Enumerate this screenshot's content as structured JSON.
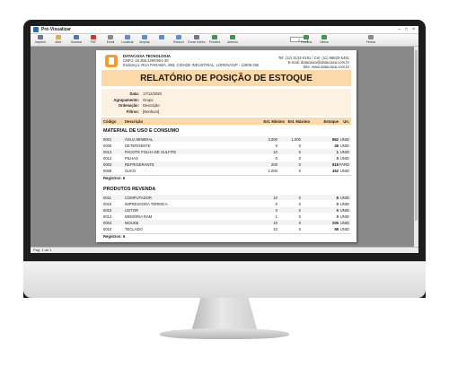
{
  "window": {
    "title": "Pré-Visualizar",
    "controls": [
      "–",
      "□",
      "×"
    ]
  },
  "toolbar": {
    "buttons": [
      {
        "label": "Imprimir",
        "icon": "printer-icon",
        "color": "#6b7a8c"
      },
      {
        "label": "Abrir",
        "icon": "open-folder-icon",
        "color": "#e0b040"
      },
      {
        "label": "Guardar",
        "icon": "save-icon",
        "color": "#4a78b8"
      },
      {
        "label": "PDF",
        "icon": "pdf-icon",
        "color": "#d9342b"
      },
      {
        "label": "Email",
        "icon": "email-icon",
        "color": "#8a8a8a"
      },
      {
        "label": "Localizar",
        "icon": "search-icon",
        "color": "#5a8fd0"
      },
      {
        "label": "Ampliar",
        "icon": "zoom-in-icon",
        "color": "#5a8fd0"
      },
      {
        "label": "",
        "icon": "zoom-icon",
        "color": "#5a8fd0"
      },
      {
        "label": "Reduzir",
        "icon": "zoom-out-icon",
        "color": "#5a8fd0"
      },
      {
        "label": "Ecran Inteiro",
        "icon": "fullscreen-icon",
        "color": "#6b7a8c"
      },
      {
        "label": "Primeira",
        "icon": "first-page-icon",
        "color": "#3a9a4a"
      },
      {
        "label": "Anterior",
        "icon": "previous-page-icon",
        "color": "#3a9a4a"
      },
      {
        "label": "Próxima",
        "icon": "next-page-icon",
        "color": "#3a9a4a"
      },
      {
        "label": "Última",
        "icon": "last-page-icon",
        "color": "#3a9a4a"
      },
      {
        "label": "Fechar",
        "icon": "close-icon",
        "color": "#8a8a8a"
      }
    ],
    "page_number": "1"
  },
  "status": {
    "text": "Pag. 1 de 1"
  },
  "report": {
    "company": {
      "name": "DATACAIXA TECNOLOGIA",
      "cnpj": "CNPJ: 16.356.429/0001-20",
      "address": "Endereço: RUA PARAIBA, 893, CIDADE INDUSTRIAL, LORENA/SP - 12609-250"
    },
    "contact": {
      "phone": "Tel: (12) 2132-0191 / Cel: (11) 98620-5451",
      "email": "E-mail: datacaixa@datacaixa.com.br",
      "site": "Site: www.datacaixa.com.br"
    },
    "title": "RELATÓRIO DE POSIÇÃO DE ESTOQUE",
    "filters": [
      {
        "label": "Data:",
        "value": "17/12/2020"
      },
      {
        "label": "Agrupamento:",
        "value": "Grupo"
      },
      {
        "label": "Ordenação:",
        "value": "Descrição"
      },
      {
        "label": "Filtros:",
        "value": "[Nenhum]"
      }
    ],
    "columns": {
      "code": "Código",
      "description": "Descrição",
      "min": "Est. Mínimo",
      "max": "Est. Máximo",
      "stock": "Estoque",
      "unit": "Un."
    },
    "groups": [
      {
        "title": "MATERIAL DE USO E CONSUMO",
        "rows": [
          {
            "code": "0001",
            "desc": "ÁGUA MINERAL",
            "min": "3.000",
            "max": "1.000",
            "stock": "882",
            "unit": "UNID"
          },
          {
            "code": "0006",
            "desc": "DETERGENTE",
            "min": "0",
            "max": "0",
            "stock": "48",
            "unit": "UNID"
          },
          {
            "code": "0013",
            "desc": "PACOTE FOLHA DE SULFITE",
            "min": "10",
            "max": "0",
            "stock": "1",
            "unit": "UNID"
          },
          {
            "code": "0014",
            "desc": "PILHAS",
            "min": "0",
            "max": "0",
            "stock": "0",
            "unit": "UNID"
          },
          {
            "code": "0003",
            "desc": "REFRIGERANTE",
            "min": "200",
            "max": "0",
            "stock": "818",
            "unit": "FARD"
          },
          {
            "code": "0008",
            "desc": "SUCO",
            "min": "1.000",
            "max": "0",
            "stock": "462",
            "unit": "UNID"
          }
        ],
        "registros": "Registros: 6"
      },
      {
        "title": "PRODUTOS REVENDA",
        "rows": [
          {
            "code": "0011",
            "desc": "COMPUTADOR",
            "min": "10",
            "max": "0",
            "stock": "8",
            "unit": "UNID"
          },
          {
            "code": "0016",
            "desc": "IMPRESSORA TÉRMICA",
            "min": "0",
            "max": "0",
            "stock": "0",
            "unit": "UNID"
          },
          {
            "code": "0015",
            "desc": "LEITOR",
            "min": "0",
            "max": "0",
            "stock": "0",
            "unit": "UNID"
          },
          {
            "code": "0012",
            "desc": "MEMÓRIA RAM",
            "min": "1",
            "max": "0",
            "stock": "0",
            "unit": "UNID"
          },
          {
            "code": "0004",
            "desc": "MOUSE",
            "min": "10",
            "max": "0",
            "stock": "205",
            "unit": "UNID"
          },
          {
            "code": "0010",
            "desc": "TECLADO",
            "min": "10",
            "max": "0",
            "stock": "98",
            "unit": "UNID"
          }
        ],
        "registros": "Registros: 6"
      }
    ]
  },
  "colors": {
    "accent": "#fbd9a9",
    "filter_bg": "#fdf1e2",
    "logo": "#f39c2b"
  }
}
